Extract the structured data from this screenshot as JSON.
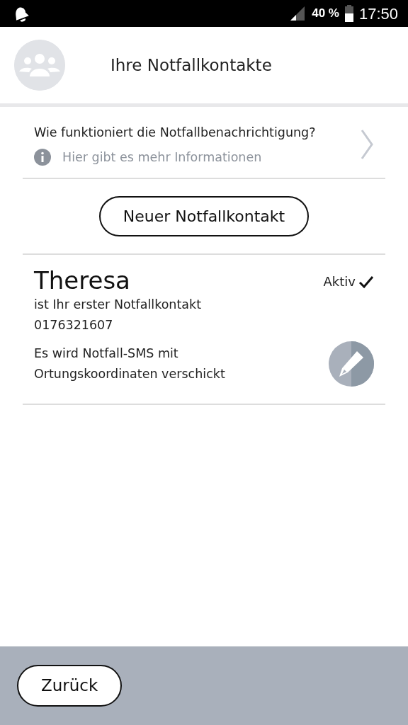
{
  "status_bar": {
    "battery": "40 %",
    "time": "17:50"
  },
  "header": {
    "title": "Ihre Notfallkontakte"
  },
  "info": {
    "question": "Wie funktioniert die Notfallbenachrichtigung?",
    "link": "Hier gibt es mehr Informationen"
  },
  "new_contact_button": "Neuer Notfallkontakt",
  "contacts": [
    {
      "name": "Theresa",
      "status": "Aktiv",
      "active": true,
      "role": "ist Ihr erster Notfallkontakt",
      "phone": "0176321607",
      "note": "Es wird Notfall-SMS mit Ortungskoordinaten verschickt"
    }
  ],
  "footer": {
    "back_button": "Zurück"
  }
}
